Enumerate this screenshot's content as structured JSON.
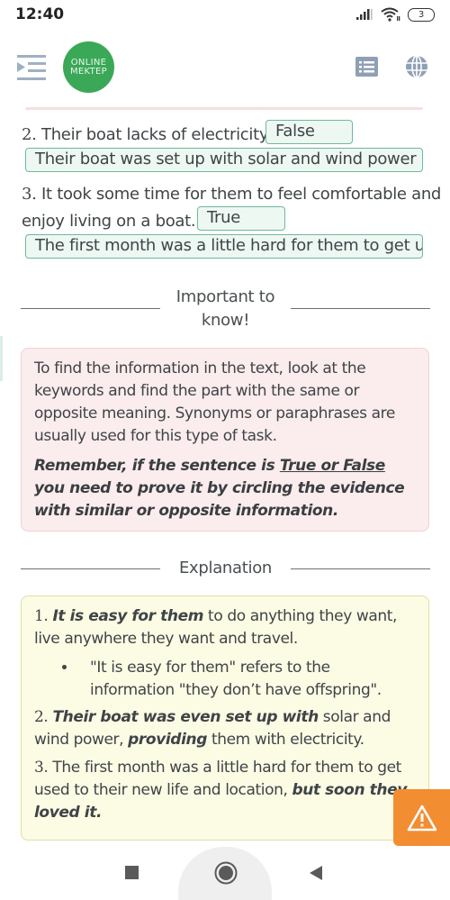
{
  "status_bar": {
    "time": "12:40",
    "battery": "3",
    "icons": [
      "signal-icon",
      "wifi-icon",
      "battery-icon"
    ]
  },
  "app_bar": {
    "logo_line1": "ONLINE",
    "logo_line2": "MEKTEP",
    "icons": [
      "menu-indent-icon",
      "list-icon",
      "globe-icon"
    ]
  },
  "colors": {
    "brand_green": "#3aa857",
    "answer_border": "#6fb99a",
    "answer_bg": "#eef8f3",
    "info_bg": "#fbeced",
    "explanation_bg": "#fcfbe4",
    "warning_orange": "#f28d31",
    "icon_gray": "#8fa0b3"
  },
  "questions": [
    {
      "number": "2.",
      "text": " Their boat lacks of electricity.",
      "answer": "False",
      "evidence": "Their boat was set up with solar and wind power p"
    },
    {
      "number": "3.",
      "text_line1": " It took some time for them to feel comfortable and",
      "text_line2": "enjoy living on a boat.",
      "answer": "True",
      "evidence": "The first month was a little hard for them to get us"
    }
  ],
  "important": {
    "heading_line1": "Important to",
    "heading_line2": "know!",
    "body": "To find the information in the text, look at the keywords and find the part with the same or opposite meaning. Synonyms or paraphrases are usually used for this type of task.",
    "remember_pre": "Remember, if the sentence is ",
    "remember_underlined": "True or False",
    "remember_post": " you need to prove it by circling the evidence with similar or opposite information."
  },
  "explanation": {
    "heading": "Explanation",
    "item1_num": "1.",
    "item1_bold": "It is easy for them",
    "item1_rest": " to do anything they want, live anywhere they want and travel.",
    "item1_bullet": "\"It is easy for them\" refers to the information \"they don’t have offspring\".",
    "item2_num": "2.",
    "item2_bold1": "Their boat was even set up with",
    "item2_mid": " solar and wind power, ",
    "item2_bold2": "providing",
    "item2_rest": " them with electricity.",
    "item3_num": "3.",
    "item3_text": " The first month was a little hard for them to get used to their new life and location, ",
    "item3_bold": "but soon they loved it."
  },
  "floating": {
    "warning_icon": "warning-icon"
  },
  "nav_bar": {
    "buttons": [
      "recents-button",
      "home-button",
      "back-button"
    ]
  }
}
